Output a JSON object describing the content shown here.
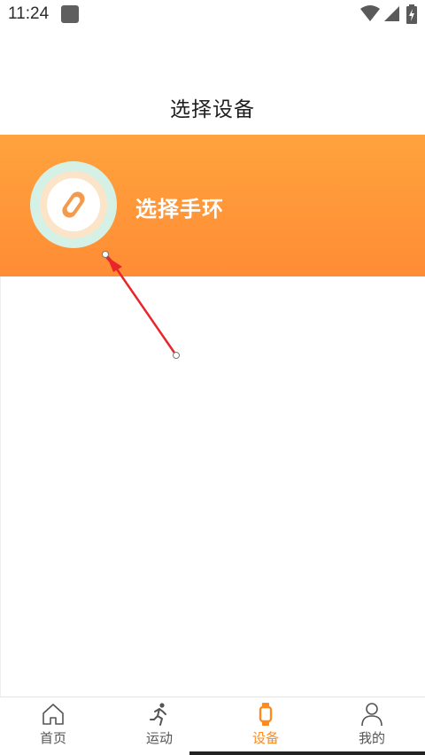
{
  "status_bar": {
    "time": "11:24"
  },
  "header": {
    "title": "选择设备"
  },
  "banner": {
    "label": "选择手环",
    "gradient_top": "#ffa33d",
    "gradient_bottom": "#ff8c35"
  },
  "bottom_nav": {
    "active_color": "#ff8a1f",
    "items": [
      {
        "label": "首页",
        "icon": "home-icon"
      },
      {
        "label": "运动",
        "icon": "running-icon"
      },
      {
        "label": "设备",
        "icon": "band-icon",
        "active": true
      },
      {
        "label": "我的",
        "icon": "person-icon"
      }
    ]
  }
}
